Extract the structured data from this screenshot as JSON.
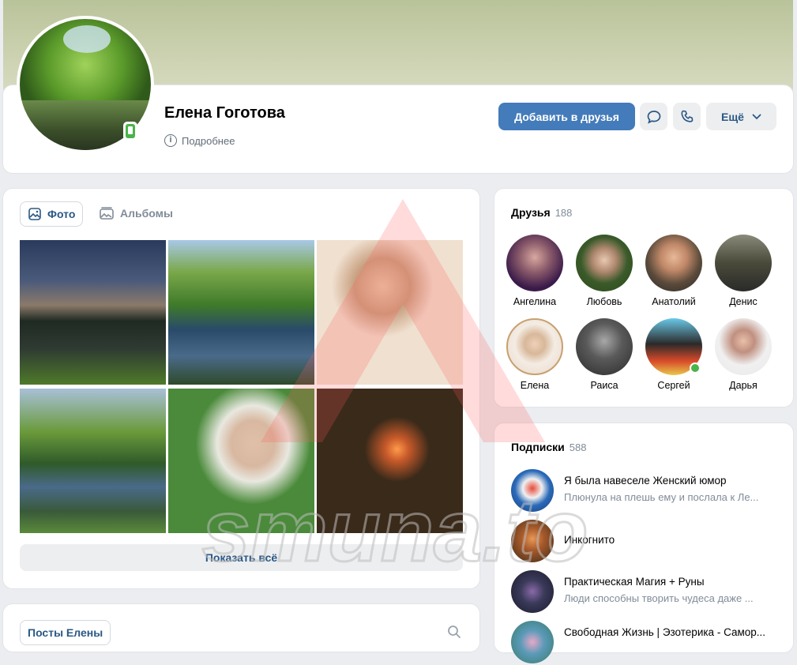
{
  "profile": {
    "name": "Елена Гоготова",
    "more_info": "Подробнее",
    "add_friend": "Добавить в друзья",
    "more_button": "Ещё"
  },
  "photos": {
    "tab_photos": "Фото",
    "tab_albums": "Альбомы",
    "show_all": "Показать всё"
  },
  "posts": {
    "tab_label": "Посты Елены"
  },
  "friends": {
    "title": "Друзья",
    "count": "188",
    "items": [
      {
        "name": "Ангелина"
      },
      {
        "name": "Любовь"
      },
      {
        "name": "Анатолий"
      },
      {
        "name": "Денис"
      },
      {
        "name": "Елена"
      },
      {
        "name": "Раиса"
      },
      {
        "name": "Сергей"
      },
      {
        "name": "Дарья"
      }
    ]
  },
  "subscriptions": {
    "title": "Подписки",
    "count": "588",
    "items": [
      {
        "title": "Я была навеселе Женский юмор",
        "desc": "Плюнула на плешь ему и послала к Ле..."
      },
      {
        "title": "Инкогнито",
        "desc": ""
      },
      {
        "title": "Практическая Магия + Руны",
        "desc": "Люди способны творить чудеса даже ..."
      },
      {
        "title": "Свободная Жизнь | Эзотерика - Самор...",
        "desc": ""
      }
    ]
  },
  "watermark": "smuna.to",
  "colors": {
    "accent": "#447bba",
    "link": "#2a5885",
    "online": "#4bb34b"
  }
}
